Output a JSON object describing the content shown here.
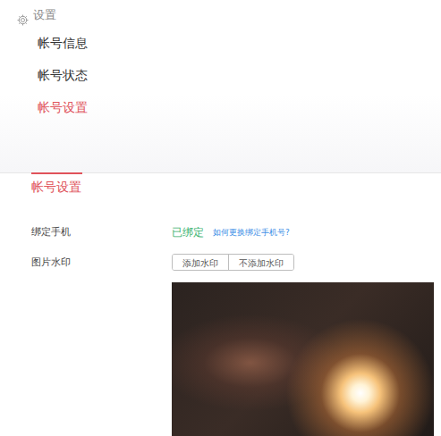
{
  "header": {
    "title": "设置"
  },
  "menu": [
    {
      "label": "帐号信息",
      "selected": false
    },
    {
      "label": "帐号状态",
      "selected": false
    },
    {
      "label": "帐号设置",
      "selected": true
    }
  ],
  "section": {
    "title": "帐号设置"
  },
  "phone": {
    "label": "绑定手机",
    "status": "已绑定",
    "link": "如何更换绑定手机号?"
  },
  "watermark": {
    "label": "图片水印",
    "options": [
      {
        "label": "添加水印",
        "selected": false
      },
      {
        "label": "不添加水印",
        "selected": false
      }
    ]
  }
}
